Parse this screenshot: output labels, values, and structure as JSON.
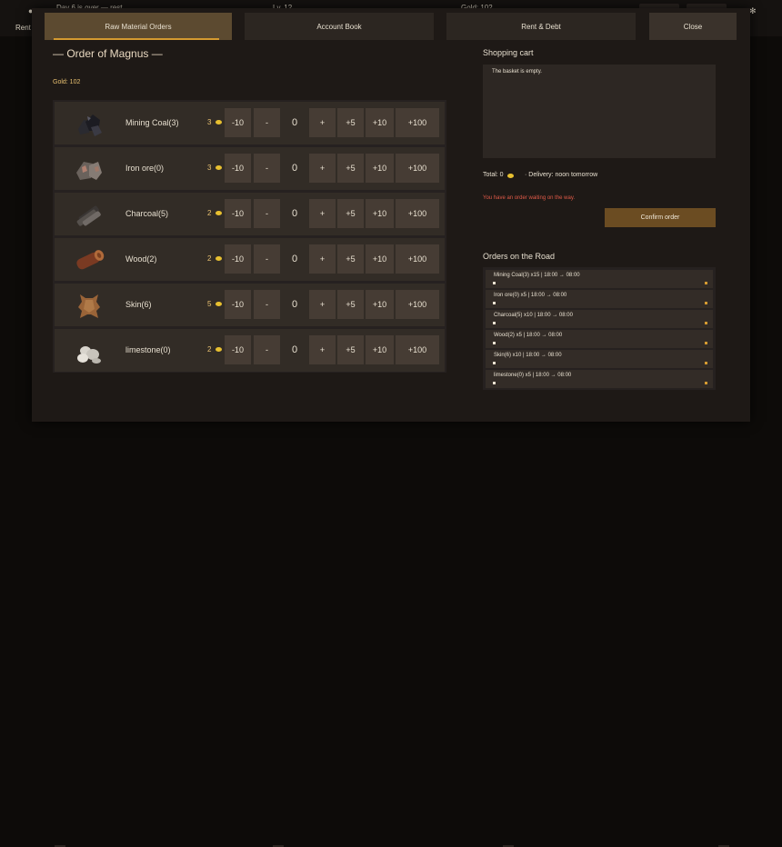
{
  "hud": {
    "day_text": "Day 6 is over — rest",
    "level_text": "Lv. 12",
    "gold_text": "Gold: 102",
    "rent_text": "Rent 1"
  },
  "tabs": [
    {
      "label": "Raw Material Orders",
      "active": true
    },
    {
      "label": "Account Book",
      "active": false
    },
    {
      "label": "Rent & Debt",
      "active": false
    },
    {
      "label": "Close",
      "active": false
    }
  ],
  "shop": {
    "title": "— Order of Magnus —",
    "gold": "Gold: 102"
  },
  "items": [
    {
      "name": "Mining Coal(3)",
      "price": "3",
      "qty": "0",
      "icon": "coal-icon"
    },
    {
      "name": "Iron ore(0)",
      "price": "3",
      "qty": "0",
      "icon": "iron-ore-icon"
    },
    {
      "name": "Charcoal(5)",
      "price": "2",
      "qty": "0",
      "icon": "charcoal-icon"
    },
    {
      "name": "Wood(2)",
      "price": "2",
      "qty": "0",
      "icon": "wood-log-icon"
    },
    {
      "name": "Skin(6)",
      "price": "5",
      "qty": "0",
      "icon": "animal-skin-icon"
    },
    {
      "name": "limestone(0)",
      "price": "2",
      "qty": "0",
      "icon": "limestone-icon"
    }
  ],
  "buttons": {
    "minus10": "-10",
    "minus": "-",
    "plus": "+",
    "plus5": "+5",
    "plus10": "+10",
    "plus100": "+100"
  },
  "cart": {
    "title": "Shopping cart",
    "empty_text": "The basket is empty.",
    "total": "Total: 0",
    "delivery": "· Delivery: noon tomorrow",
    "warning": "You have an order waiting on the way.",
    "confirm_label": "Confirm order"
  },
  "road": {
    "title": "Orders on the Road",
    "orders": [
      "Mining Coal(3) x15 | 18:00 → 08:00",
      "Iron ore(0) x5 | 18:00 → 08:00",
      "Charcoal(5) x10 | 18:00 → 08:00",
      "Wood(2) x5 | 18:00 → 08:00",
      "Skin(6) x10 | 18:00 → 08:00",
      "limestone(0) x5 | 18:00 → 08:00"
    ]
  },
  "colors": {
    "accent": "#d49a30",
    "gold": "#e8c070",
    "warning": "#e05a48",
    "confirm": "#6b4c22"
  }
}
